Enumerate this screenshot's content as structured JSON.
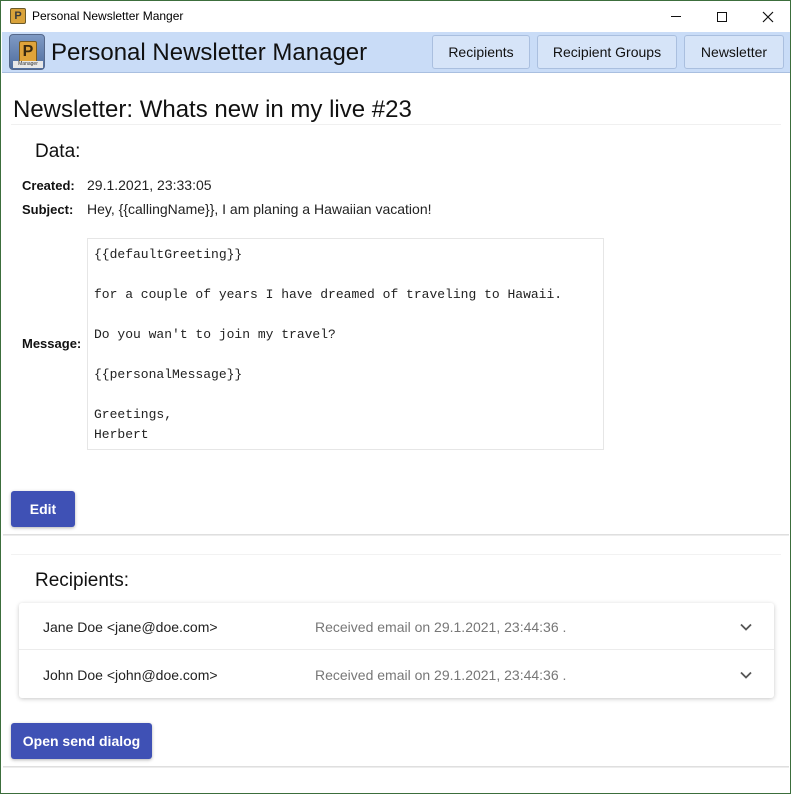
{
  "window": {
    "title": "Personal Newsletter Manger"
  },
  "appbar": {
    "title": "Personal Newsletter Manager",
    "logo_letter": "P",
    "logo_caption": "Manager",
    "nav": [
      {
        "label": "Recipients"
      },
      {
        "label": "Recipient Groups"
      },
      {
        "label": "Newsletter"
      }
    ]
  },
  "page": {
    "heading": "Newsletter: Whats new in my live #23"
  },
  "data_section": {
    "title": "Data:",
    "created_label": "Created:",
    "created_value": "29.1.2021, 23:33:05",
    "subject_label": "Subject:",
    "subject_value": "Hey, {{callingName}}, I am planing a Hawaiian vacation!",
    "message_label": "Message:",
    "message_value": "{{defaultGreeting}}\n\nfor a couple of years I have dreamed of traveling to Hawaii.\n\nDo you wan't to join my travel?\n\n{{personalMessage}}\n\nGreetings,\nHerbert",
    "edit_label": "Edit"
  },
  "recipients_section": {
    "title": "Recipients:",
    "items": [
      {
        "name": "Jane Doe <jane@doe.com>",
        "status": "Received email on 29.1.2021, 23:44:36 ."
      },
      {
        "name": "John Doe <john@doe.com>",
        "status": "Received email on 29.1.2021, 23:44:36 ."
      }
    ],
    "send_label": "Open send dialog"
  },
  "colors": {
    "appbar": "#c9dcf7",
    "primary": "#3f51b5"
  }
}
